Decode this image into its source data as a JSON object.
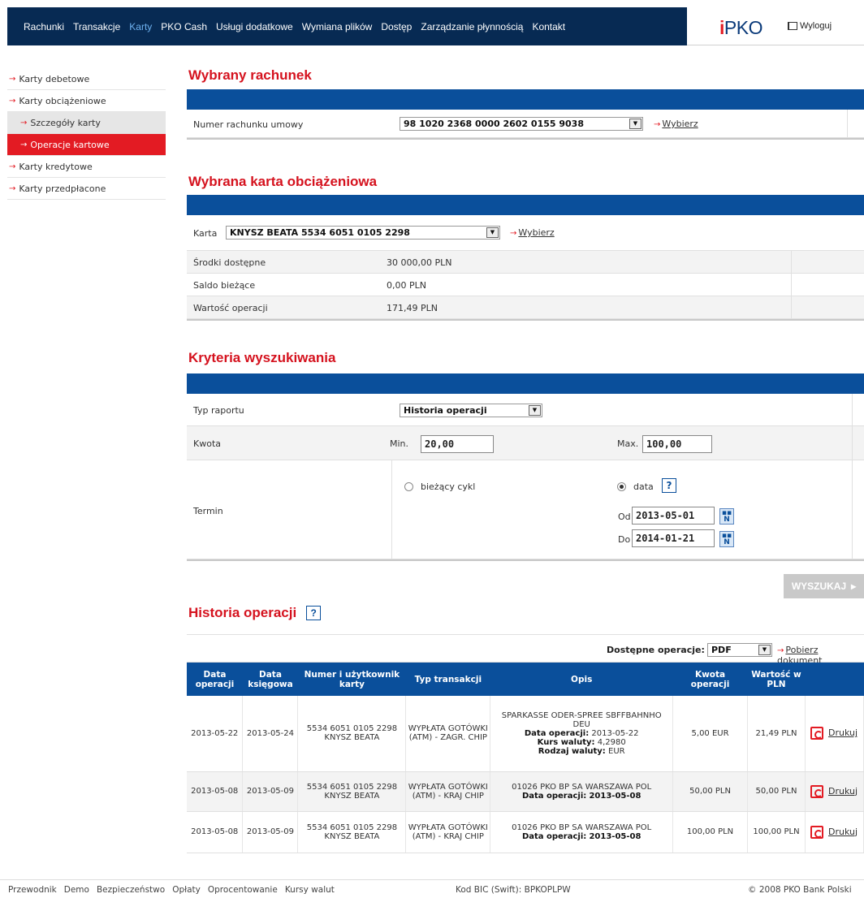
{
  "topnav": {
    "items": [
      "Rachunki",
      "Transakcje",
      "Karty",
      "PKO Cash",
      "Usługi dodatkowe",
      "Wymiana plików",
      "Dostęp",
      "Zarządzanie płynnością",
      "Kontakt"
    ],
    "active": "Karty",
    "logo": "PKO",
    "logout": "Wyloguj"
  },
  "sidebar": {
    "items": [
      {
        "label": "Karty debetowe"
      },
      {
        "label": "Karty obciążeniowe"
      },
      {
        "label": "Szczegóły karty"
      },
      {
        "label": "Operacje kartowe"
      },
      {
        "label": "Karty kredytowe"
      },
      {
        "label": "Karty przedpłacone"
      }
    ]
  },
  "account": {
    "title": "Wybrany rachunek",
    "label": "Numer rachunku umowy",
    "value": "98 1020 2368 0000 2602 0155 9038",
    "choose": "Wybierz"
  },
  "card": {
    "title": "Wybrana karta obciążeniowa",
    "label": "Karta",
    "value": "KNYSZ BEATA 5534 6051 0105 2298",
    "choose": "Wybierz",
    "rows": [
      {
        "label": "Środki dostępne",
        "value": "30 000,00 PLN"
      },
      {
        "label": "Saldo bieżące",
        "value": "0,00 PLN"
      },
      {
        "label": "Wartość operacji",
        "value": "171,49 PLN"
      }
    ]
  },
  "criteria": {
    "title": "Kryteria wyszukiwania",
    "report_label": "Typ raportu",
    "report_value": "Historia operacji",
    "amount_label": "Kwota",
    "min_label": "Min.",
    "min_value": "20,00",
    "max_label": "Max.",
    "max_value": "100,00",
    "term_label": "Termin",
    "current_cycle": "bieżący cykl",
    "date_option": "data",
    "from_label": "Od",
    "from_value": "2013-05-01",
    "to_label": "Do",
    "to_value": "2014-01-21",
    "help": "?",
    "cal_icon_text": "N",
    "search_button": "WYSZUKAJ"
  },
  "history": {
    "title": "Historia operacji",
    "help": "?",
    "ops_label": "Dostępne operacje:",
    "ops_value": "PDF",
    "download": "Pobierz dokument",
    "headers": [
      "Data operacji",
      "Data księgowa",
      "Numer i użytkownik karty",
      "Typ transakcji",
      "Opis",
      "Kwota operacji",
      "Wartość w PLN",
      ""
    ],
    "rows": [
      {
        "op_date": "2013-05-22",
        "book_date": "2013-05-24",
        "card_no": "5534 6051 0105 2298",
        "card_user": "KNYSZ BEATA",
        "type": "WYPŁATA GOTÓWKI (ATM) - ZAGR. CHIP",
        "desc": "SPARKASSE ODER-SPREE SBFFBAHNHO DEU",
        "desc_date_label": "Data operacji:",
        "desc_date": "2013-05-22",
        "rate_label": "Kurs waluty:",
        "rate": "4,2980",
        "cur_label": "Rodzaj waluty:",
        "cur": "EUR",
        "amount": "5,00 EUR",
        "value_pln": "21,49 PLN",
        "print": "Drukuj"
      },
      {
        "op_date": "2013-05-08",
        "book_date": "2013-05-09",
        "card_no": "5534 6051 0105 2298",
        "card_user": "KNYSZ BEATA",
        "type": "WYPŁATA GOTÓWKI (ATM) - KRAJ CHIP",
        "desc": "01026 PKO BP SA WARSZAWA POL",
        "desc_date_label": "Data operacji:",
        "desc_date": "2013-05-08",
        "amount": "50,00 PLN",
        "value_pln": "50,00 PLN",
        "print": "Drukuj"
      },
      {
        "op_date": "2013-05-08",
        "book_date": "2013-05-09",
        "card_no": "5534 6051 0105 2298",
        "card_user": "KNYSZ BEATA",
        "type": "WYPŁATA GOTÓWKI (ATM) - KRAJ CHIP",
        "desc": "01026 PKO BP SA WARSZAWA POL",
        "desc_date_label": "Data operacji:",
        "desc_date": "2013-05-08",
        "amount": "100,00 PLN",
        "value_pln": "100,00 PLN",
        "print": "Drukuj"
      }
    ]
  },
  "footer": {
    "links": [
      "Przewodnik",
      "Demo",
      "Bezpieczeństwo",
      "Opłaty",
      "Oprocentowanie",
      "Kursy walut"
    ],
    "bic": "Kod BIC (Swift): BPKOPLPW",
    "copyright": "© 2008 PKO Bank Polski"
  },
  "colors": {
    "navy": "#072a53",
    "blue": "#0a4f9b",
    "red": "#e31b23"
  }
}
